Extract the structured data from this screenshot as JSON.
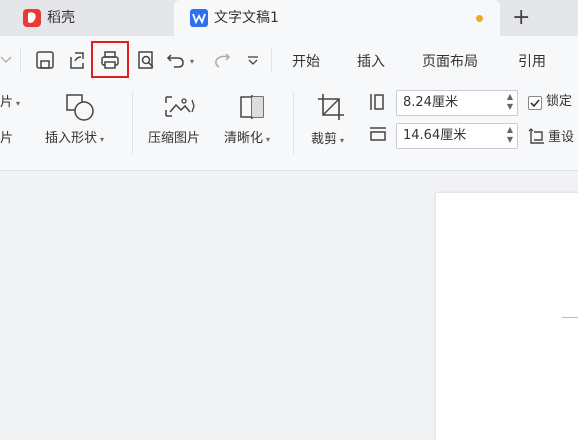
{
  "tabs": {
    "daoke": "稻壳",
    "document": "文字文稿1",
    "new_tab": "+"
  },
  "menu": {
    "start": "开始",
    "insert": "插入",
    "layout": "页面布局",
    "reference": "引用"
  },
  "ribbon": {
    "pic_top": "片",
    "pic_bottom": "片",
    "insert_shape": "插入形状",
    "compress_picture": "压缩图片",
    "sharpen": "清晰化",
    "crop": "裁剪",
    "height_value": "8.24厘米",
    "width_value": "14.64厘米",
    "lock": "锁定",
    "reset": "重设"
  },
  "colors": {
    "accent": "#2f6ff1",
    "daoke": "#e83a33",
    "highlight": "#e21d1d",
    "unsaved_dot": "#f5a623"
  }
}
